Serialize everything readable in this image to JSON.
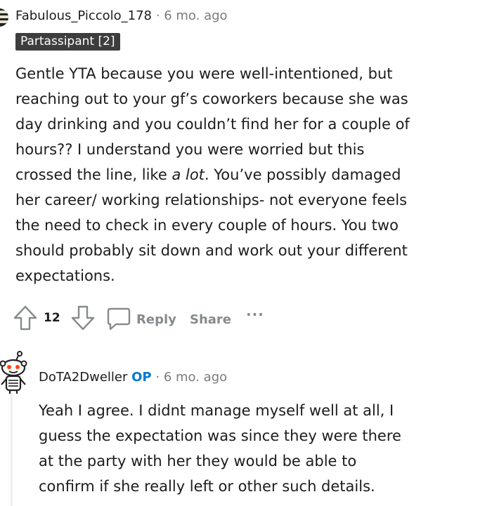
{
  "comment": {
    "username": "Fabulous_Piccolo_178",
    "separator": "·",
    "time": "6 mo. ago",
    "flair": "Partassipant [2]",
    "lines": [
      "Gentle YTA because you were well-intentioned, but",
      "reaching out to your gf’s coworkers because she was",
      "day drinking and you couldn’t find her for a couple of",
      "hours?? I understand you were worried but this",
      "expectations."
    ],
    "line5_prefix": "crossed the line, like ",
    "line5_em": "a lot",
    "line5_suffix": ". You’ve possibly damaged",
    "lines_after": [
      "her career/ working relationships- not everyone feels",
      "the need to check in every couple of hours. You two",
      "should probably sit down and work out your different",
      "expectations."
    ],
    "votes": "12",
    "reply_label": "Reply",
    "share_label": "Share",
    "more_label": "···",
    "icons": [
      "upvote-icon",
      "downvote-icon",
      "comment-bubble-icon",
      "more-icon"
    ]
  },
  "reply": {
    "username": "DoTA2Dweller",
    "op_badge": "OP",
    "separator": "·",
    "time": "6 mo. ago",
    "lines": [
      "Yeah I agree. I didnt manage myself well at all, I",
      "guess the expectation was since they were there",
      "at the party with her they would be able to",
      "confirm if she really left or other such details."
    ]
  },
  "colors": {
    "text": "#1c1c1c",
    "muted": "#7c7c7c",
    "action": "#878a8c",
    "op": "#0079d3",
    "flair_bg": "#3d3d3d"
  }
}
